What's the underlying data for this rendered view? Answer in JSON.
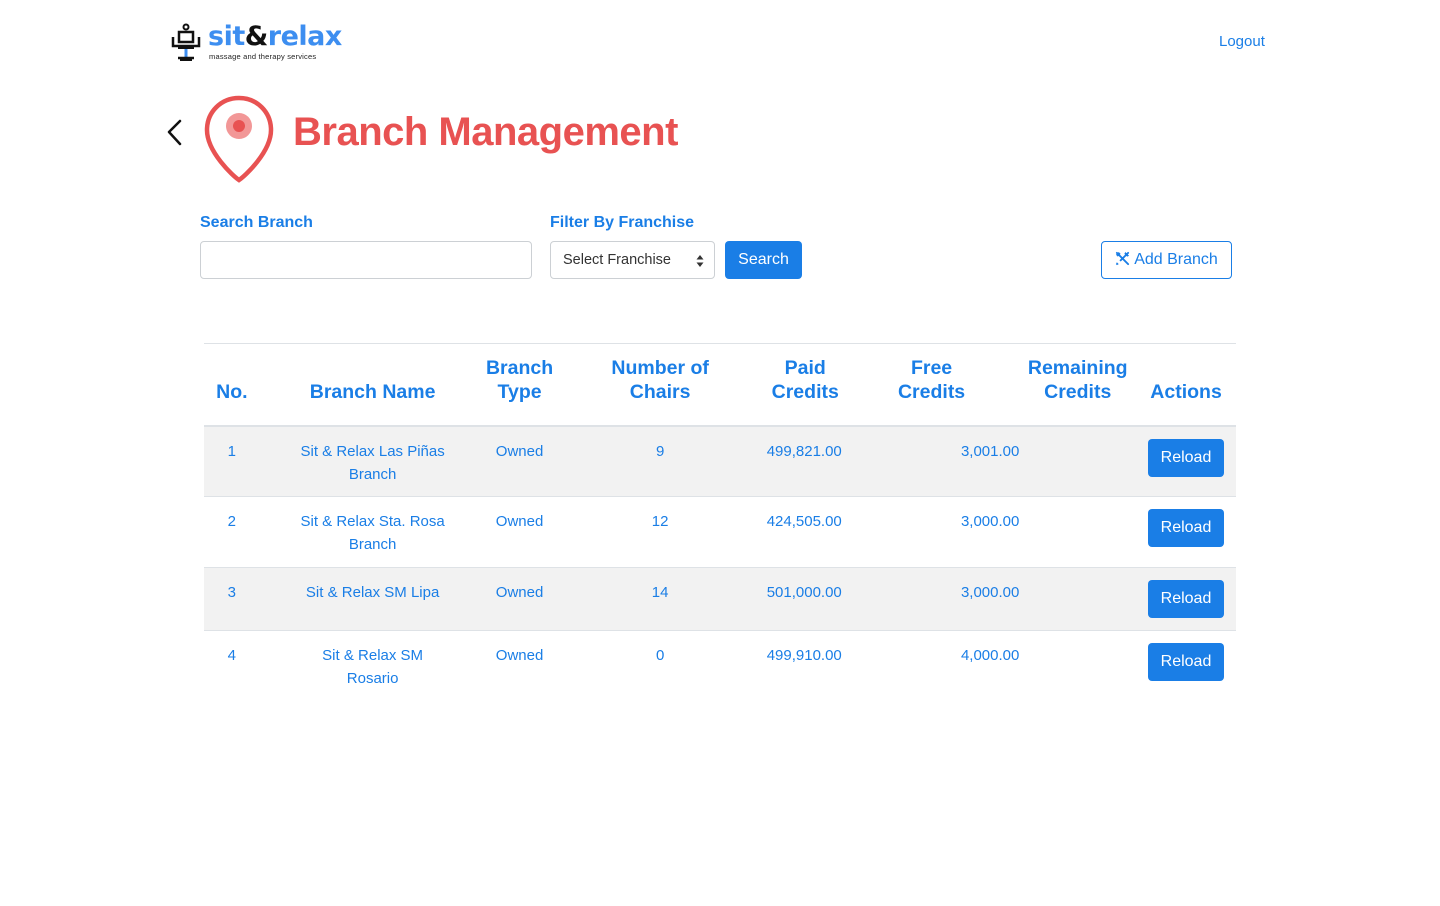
{
  "brand": {
    "name_part1": "sit",
    "name_amp": "&",
    "name_part2": "relax",
    "tagline": "massage and therapy services",
    "icon": "massage-chair-icon"
  },
  "header": {
    "logout_label": "Logout"
  },
  "page": {
    "title": "Branch Management",
    "back_icon": "chevron-left-icon",
    "title_icon": "map-pin-icon",
    "title_color": "#e85252",
    "accent_color": "#1a7ee6"
  },
  "filters": {
    "search_label": "Search Branch",
    "search_value": "",
    "filter_label": "Filter By Franchise",
    "franchise_selected": "Select Franchise",
    "search_button": "Search",
    "add_button": "Add Branch"
  },
  "table": {
    "columns": [
      {
        "line1": "",
        "line2": "No."
      },
      {
        "line1": "",
        "line2": "Branch Name"
      },
      {
        "line1": "Branch",
        "line2": "Type"
      },
      {
        "line1": "Number of",
        "line2": "Chairs"
      },
      {
        "line1": "Paid",
        "line2": "Credits"
      },
      {
        "line1": "Free",
        "line2": "Credits"
      },
      {
        "line1": "Remaining",
        "line2": "Credits"
      },
      {
        "line1": "",
        "line2": "Actions"
      }
    ],
    "rows": [
      {
        "no": "1",
        "name_line1": "Sit & Relax Las Piñas",
        "name_line2": "Branch",
        "type": "Owned",
        "chairs": "9",
        "paid": "499,821.00",
        "free": "3,001.00",
        "remaining": "",
        "action": "Reload"
      },
      {
        "no": "2",
        "name_line1": "Sit & Relax Sta. Rosa",
        "name_line2": "Branch",
        "type": "Owned",
        "chairs": "12",
        "paid": "424,505.00",
        "free": "3,000.00",
        "remaining": "",
        "action": "Reload"
      },
      {
        "no": "3",
        "name_line1": "Sit & Relax SM Lipa",
        "name_line2": "",
        "type": "Owned",
        "chairs": "14",
        "paid": "501,000.00",
        "free": "3,000.00",
        "remaining": "",
        "action": "Reload"
      },
      {
        "no": "4",
        "name_line1": "Sit & Relax SM",
        "name_line2": "Rosario",
        "type": "Owned",
        "chairs": "0",
        "paid": "499,910.00",
        "free": "4,000.00",
        "remaining": "",
        "action": "Reload"
      }
    ]
  }
}
